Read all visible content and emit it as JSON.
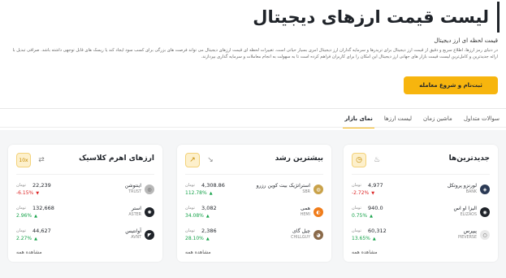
{
  "page": {
    "title": "لیست قیمت ارزهای دیجیتال",
    "subtitle": "قیمت لحظه ای ارز دیجیتال",
    "description": "در دنیای رمز ارزها، اطلاع سریع و دقیق از قیمت ارز دیجیتال برای تریدرها و سرمایه گذاران ارز دیجیتال امری بسیار حیاتی است. تغییرات لحظه ای قیمت ارزهای دیجیتال می تواند فرصت های بزرگی برای کسب سود ایجاد کند یا ریسک های قابل توجهی داشته باشد. صرافی تبدیل با ارائه جدیدترین و کامل‌ترین لیست قیمت بازار های جهانی ارز دیجیتال این امکان را برای کاربران فراهم کرده است تا به سهولت به انجام معاملات و سرمایه گذاری بپردازند.",
    "cta_label": "ثبت‌نام و شروع معامله"
  },
  "tabs": [
    {
      "label": "نمای بازار",
      "active": true
    },
    {
      "label": "لیست ارزها",
      "active": false
    },
    {
      "label": "ماشین زمان",
      "active": false
    },
    {
      "label": "سوالات متداول",
      "active": false
    }
  ],
  "cards": [
    {
      "title": "جدیدترین‌ها",
      "btn_a_icon": "clock-icon",
      "btn_b_icon": "fire-icon",
      "more_label": "مشاهده همه",
      "rows": [
        {
          "name": "لورنزو پروتکل",
          "symbol": "BANK",
          "price": "4,977",
          "unit": "تومان",
          "change": "-2.72%",
          "dir": "down",
          "icon_color": "#2b3a55",
          "icon_glyph": "◈"
        },
        {
          "name": "الیزا او اس",
          "symbol": "ELIZAOS",
          "price": "940.0",
          "unit": "تومان",
          "change": "0.75%",
          "dir": "up",
          "icon_color": "#1f2329",
          "icon_glyph": "◉"
        },
        {
          "name": "پیپرس",
          "symbol": "PIEVERSE",
          "price": "60,312",
          "unit": "تومان",
          "change": "13.65%",
          "dir": "up",
          "icon_color": "#e9e9e9",
          "icon_glyph": "○"
        }
      ]
    },
    {
      "title": "بیشترین رشد",
      "btn_a_icon": "trend-up-icon",
      "btn_b_icon": "trend-down-icon",
      "more_label": "مشاهده همه",
      "rows": [
        {
          "name": "استراتژیک بیت کوین رزرو",
          "symbol": "SBR",
          "price": "4,308.86",
          "unit": "تومان",
          "change": "112.78%",
          "dir": "up",
          "icon_color": "#c9a24a",
          "icon_glyph": "◍"
        },
        {
          "name": "همی",
          "symbol": "HEMI",
          "price": "3,082",
          "unit": "تومان",
          "change": "34.08%",
          "dir": "up",
          "icon_color": "#f07c1a",
          "icon_glyph": "◐"
        },
        {
          "name": "چیل گای",
          "symbol": "CHILLGUY",
          "price": "2,386",
          "unit": "تومان",
          "change": "28.10%",
          "dir": "up",
          "icon_color": "#8a6a4a",
          "icon_glyph": "◕"
        }
      ]
    },
    {
      "title": "ارزهای اهرم کلاسیک",
      "btn_a_icon": "leverage-10x-icon",
      "btn_a_text": "10x",
      "btn_b_icon": "swap-icon",
      "more_label": "مشاهده همه",
      "rows": [
        {
          "name": "اینتوشن",
          "symbol": "TRUST",
          "price": "22,239",
          "unit": "تومان",
          "change": "-6.15%",
          "dir": "down",
          "icon_color": "#b8b8b8",
          "icon_glyph": "◎"
        },
        {
          "name": "استر",
          "symbol": "ASTER",
          "price": "132,668",
          "unit": "تومان",
          "change": "2.96%",
          "dir": "up",
          "icon_color": "#1f2329",
          "icon_glyph": "✺"
        },
        {
          "name": "آوانتیس",
          "symbol": "AVNT",
          "price": "44,627",
          "unit": "تومان",
          "change": "2.27%",
          "dir": "up",
          "icon_color": "#1f2329",
          "icon_glyph": "◤"
        }
      ]
    }
  ]
}
